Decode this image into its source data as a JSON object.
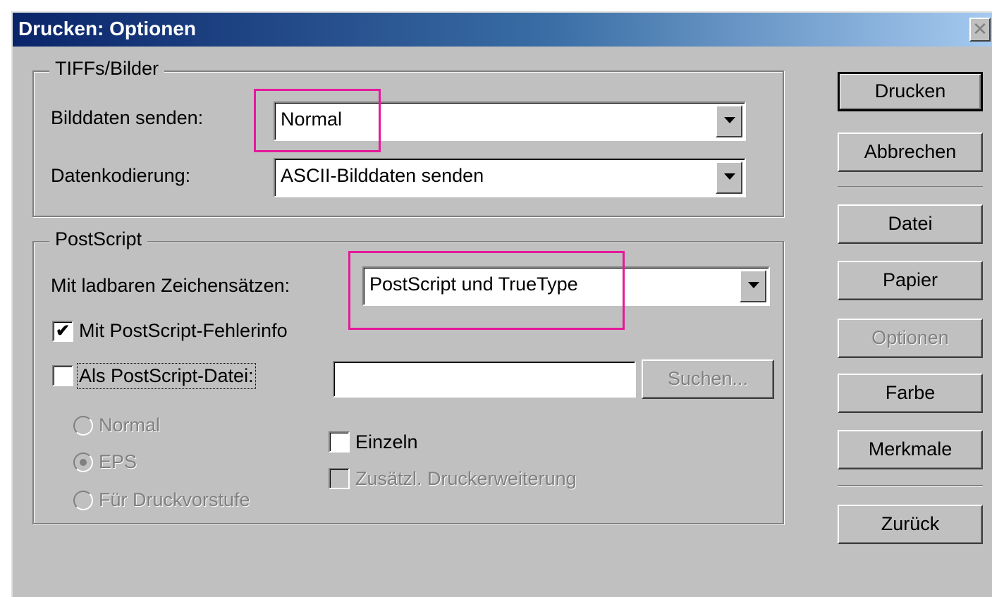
{
  "window": {
    "title": "Drucken: Optionen",
    "close_glyph": "✕"
  },
  "tiffs": {
    "legend": "TIFFs/Bilder",
    "bilddaten_label": "Bilddaten senden:",
    "bilddaten_value": "Normal",
    "kodierung_label": "Datenkodierung:",
    "kodierung_value": "ASCII-Bilddaten senden"
  },
  "postscript": {
    "legend": "PostScript",
    "fonts_label": "Mit ladbaren Zeichensätzen:",
    "fonts_value": "PostScript und TrueType",
    "errinfo_label": "Mit PostScript-Fehlerinfo",
    "errinfo_checked": true,
    "errinfo_mark": "✔",
    "psfile_label": "Als PostScript-Datei:",
    "psfile_checked": false,
    "psfile_path": "",
    "browse_label": "Suchen...",
    "radio_normal": "Normal",
    "radio_eps": "EPS",
    "radio_prepress": "Für Druckvorstufe",
    "single_label": "Einzeln",
    "extension_label": "Zusätzl. Druckerweiterung"
  },
  "buttons": {
    "print": "Drucken",
    "cancel": "Abbrechen",
    "file": "Datei",
    "paper": "Papier",
    "options": "Optionen",
    "color": "Farbe",
    "features": "Merkmale",
    "back": "Zurück"
  },
  "colors": {
    "highlight": "#e6189b",
    "titlebar": "#0a246a",
    "face": "#c0c0c0"
  }
}
